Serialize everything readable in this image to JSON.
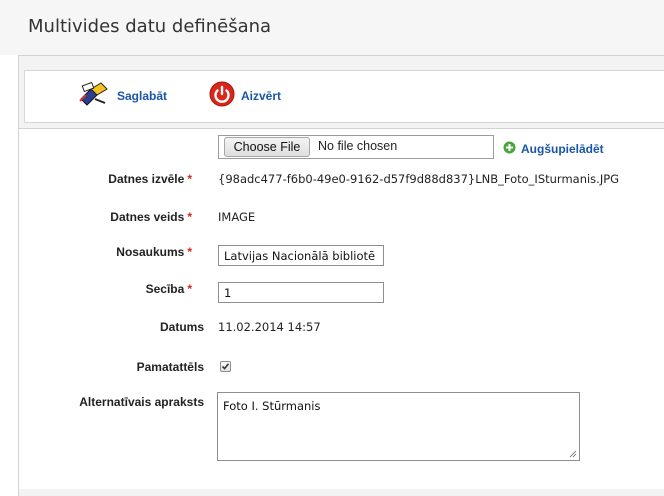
{
  "window": {
    "title": "Multivides datu definēšana"
  },
  "toolbar": {
    "save_label": "Saglabāt",
    "close_label": "Aizvērt"
  },
  "file": {
    "button_label": "Choose File",
    "status": "No file chosen",
    "upload_label": "Augšupielādēt"
  },
  "form": {
    "file_label": "Datnes izvēle",
    "file_value": "{98adc477-f6b0-49e0-9162-d57f9d88d837}LNB_Foto_ISturmanis.JPG",
    "type_label": "Datnes veids",
    "type_value": "IMAGE",
    "name_label": "Nosaukums",
    "name_value": "Latvijas Nacionālā bibliotē",
    "order_label": "Secība",
    "order_value": "1",
    "date_label": "Datums",
    "date_value": "11.02.2014 14:57",
    "main_image_label": "Pamatattēls",
    "main_image_checked": true,
    "alt_label": "Alternatīvais apraksts",
    "alt_value": "Foto I. Stūrmanis",
    "required_mark": "*"
  },
  "colors": {
    "link": "#1a56a8",
    "required": "#d9271c",
    "close_icon": "#d9271c",
    "upload_icon": "#4aa63a"
  }
}
